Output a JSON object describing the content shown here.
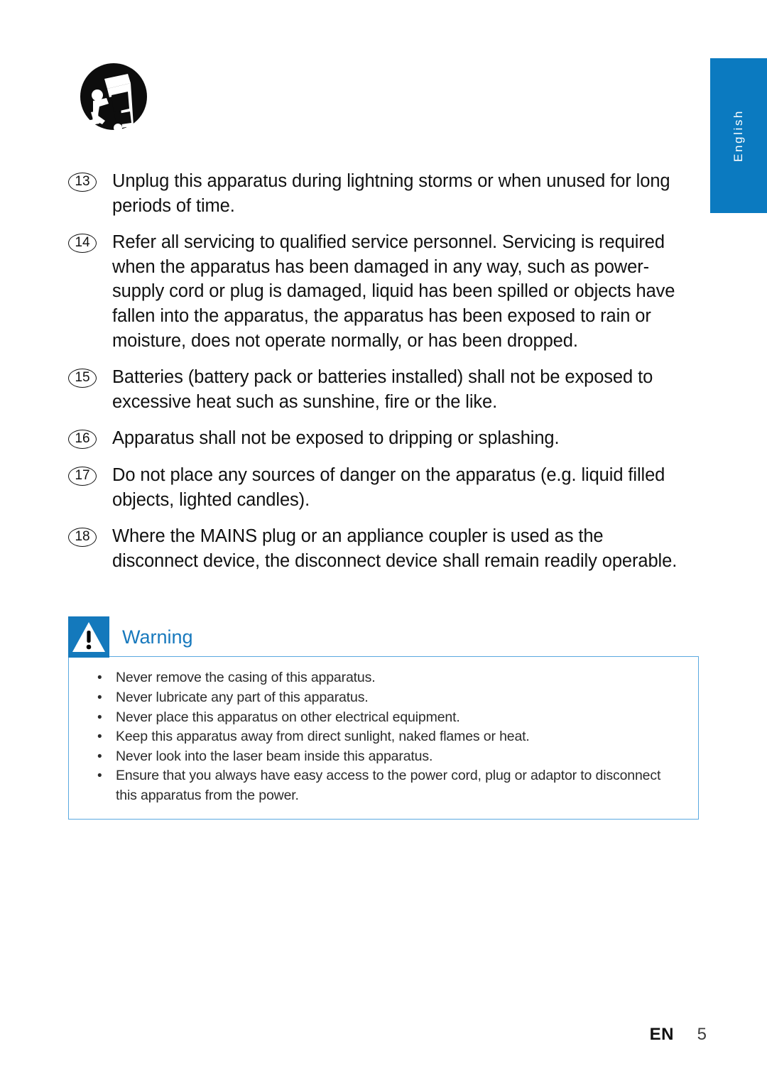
{
  "page": {
    "language_tab": "English",
    "footer": {
      "language_code": "EN",
      "page_number": "5"
    }
  },
  "pictogram": {
    "name": "cart-tipping-warning-symbol",
    "description": "Portable cart tip-over hazard symbol"
  },
  "safety_list": {
    "items": [
      {
        "number": "13",
        "text": "Unplug this apparatus during lightning storms or when unused for long periods of time."
      },
      {
        "number": "14",
        "text": "Refer all servicing to qualified service personnel. Servicing is required when the apparatus has been damaged in any way, such as power-supply cord or plug is damaged, liquid has been spilled or objects have fallen into the apparatus, the apparatus has been exposed to rain or moisture, does not operate normally, or has been dropped."
      },
      {
        "number": "15",
        "text": "Batteries (battery pack or batteries installed) shall not be exposed to excessive heat such as sunshine, fire or the like."
      },
      {
        "number": "16",
        "text": "Apparatus shall not be exposed to dripping or splashing."
      },
      {
        "number": "17",
        "text": "Do not place any sources of danger on the apparatus (e.g. liquid filled objects, lighted candles)."
      },
      {
        "number": "18",
        "text": "Where the MAINS plug or an appliance coupler is used as the disconnect device, the disconnect device shall remain readily operable."
      }
    ]
  },
  "warning": {
    "title": "Warning",
    "icon": "warning-triangle-icon",
    "bullets": [
      "Never remove the casing of this apparatus.",
      "Never lubricate any part of this apparatus.",
      "Never place this apparatus on other electrical equipment.",
      "Keep this apparatus away from direct sunlight, naked flames or heat.",
      "Never look into the laser beam inside this apparatus.",
      "Ensure that you always have easy access to the power cord, plug or adaptor to disconnect this apparatus from the power."
    ]
  },
  "colors": {
    "brand_blue": "#0b7ac0",
    "warning_blue": "#1879bd",
    "warning_icon_blue": "#1479bc",
    "warning_border_blue": "#5aa9e0",
    "text_black": "#111111"
  }
}
